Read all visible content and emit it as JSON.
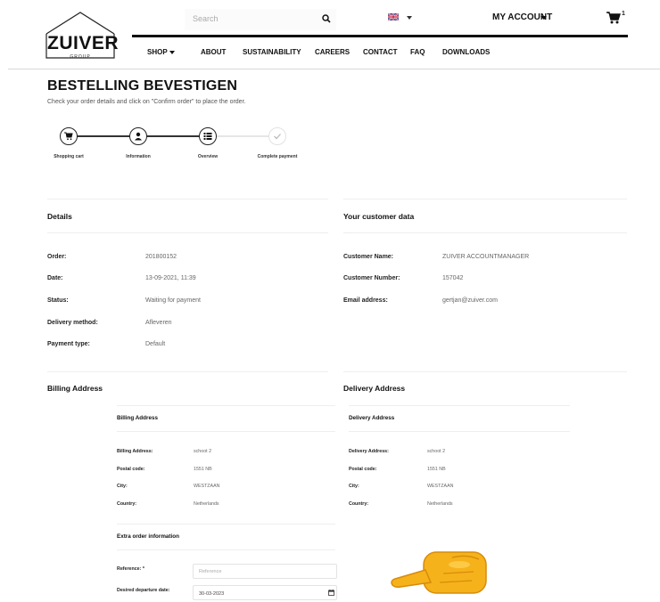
{
  "header": {
    "logo_text": "ZUIVER",
    "logo_sub": "GROUP",
    "search_placeholder": "Search",
    "language_flag": "uk-flag-icon",
    "account_label": "MY ACCOUNT",
    "cart_count": "1",
    "nav": [
      {
        "label": "SHOP"
      },
      {
        "label": "ABOUT"
      },
      {
        "label": "SUSTAINABILITY"
      },
      {
        "label": "CAREERS"
      },
      {
        "label": "CONTACT"
      },
      {
        "label": "FAQ"
      },
      {
        "label": "DOWNLOADS"
      }
    ]
  },
  "page": {
    "title": "BESTELLING BEVESTIGEN",
    "subtitle": "Check your order details and click on \"Confirm order\" to place the order."
  },
  "steps": [
    {
      "label": "Shopping cart",
      "icon": "cart-icon"
    },
    {
      "label": "Information",
      "icon": "user-icon"
    },
    {
      "label": "Overview",
      "icon": "list-icon"
    },
    {
      "label": "Complete payment",
      "icon": "check-icon"
    }
  ],
  "details": {
    "title": "Details",
    "rows": [
      {
        "label": "Order:",
        "value": "201800152"
      },
      {
        "label": "Date:",
        "value": "13-09-2021, 11:39"
      },
      {
        "label": "Status:",
        "value": "Waiting for payment"
      },
      {
        "label": "Delivery method:",
        "value": "Afleveren"
      },
      {
        "label": "Payment type:",
        "value": "Default"
      }
    ]
  },
  "customer": {
    "title": "Your customer data",
    "rows": [
      {
        "label": "Customer Name:",
        "value": "ZUIVER ACCOUNTMANAGER"
      },
      {
        "label": "Customer Number:",
        "value": "157042"
      },
      {
        "label": "Email address:",
        "value": "gertjan@zuiver.com"
      }
    ]
  },
  "billing": {
    "title": "Billing Address",
    "subtitle": "Billing Address",
    "rows": [
      {
        "label": "Billing Address:",
        "value": "schoot 2"
      },
      {
        "label": "Postal code:",
        "value": "1551 NB"
      },
      {
        "label": "City:",
        "value": "WESTZAAN"
      },
      {
        "label": "Country:",
        "value": "Netherlands"
      }
    ]
  },
  "delivery": {
    "title": "Delivery Address",
    "subtitle": "Delivery Address",
    "rows": [
      {
        "label": "Delivery Address:",
        "value": "schoot 2"
      },
      {
        "label": "Postal code:",
        "value": "1551 NB"
      },
      {
        "label": "City:",
        "value": "WESTZAAN"
      },
      {
        "label": "Country:",
        "value": "Netherlands"
      }
    ]
  },
  "extra": {
    "title": "Extra order information",
    "reference_label": "Reference: *",
    "reference_placeholder": "Reference",
    "departure_label": "Desired departure date:",
    "departure_value": "30-03-2023"
  },
  "colors": {
    "text": "#222222",
    "muted": "#666666",
    "divider": "#eeeeee",
    "hand": "#f5b400"
  }
}
